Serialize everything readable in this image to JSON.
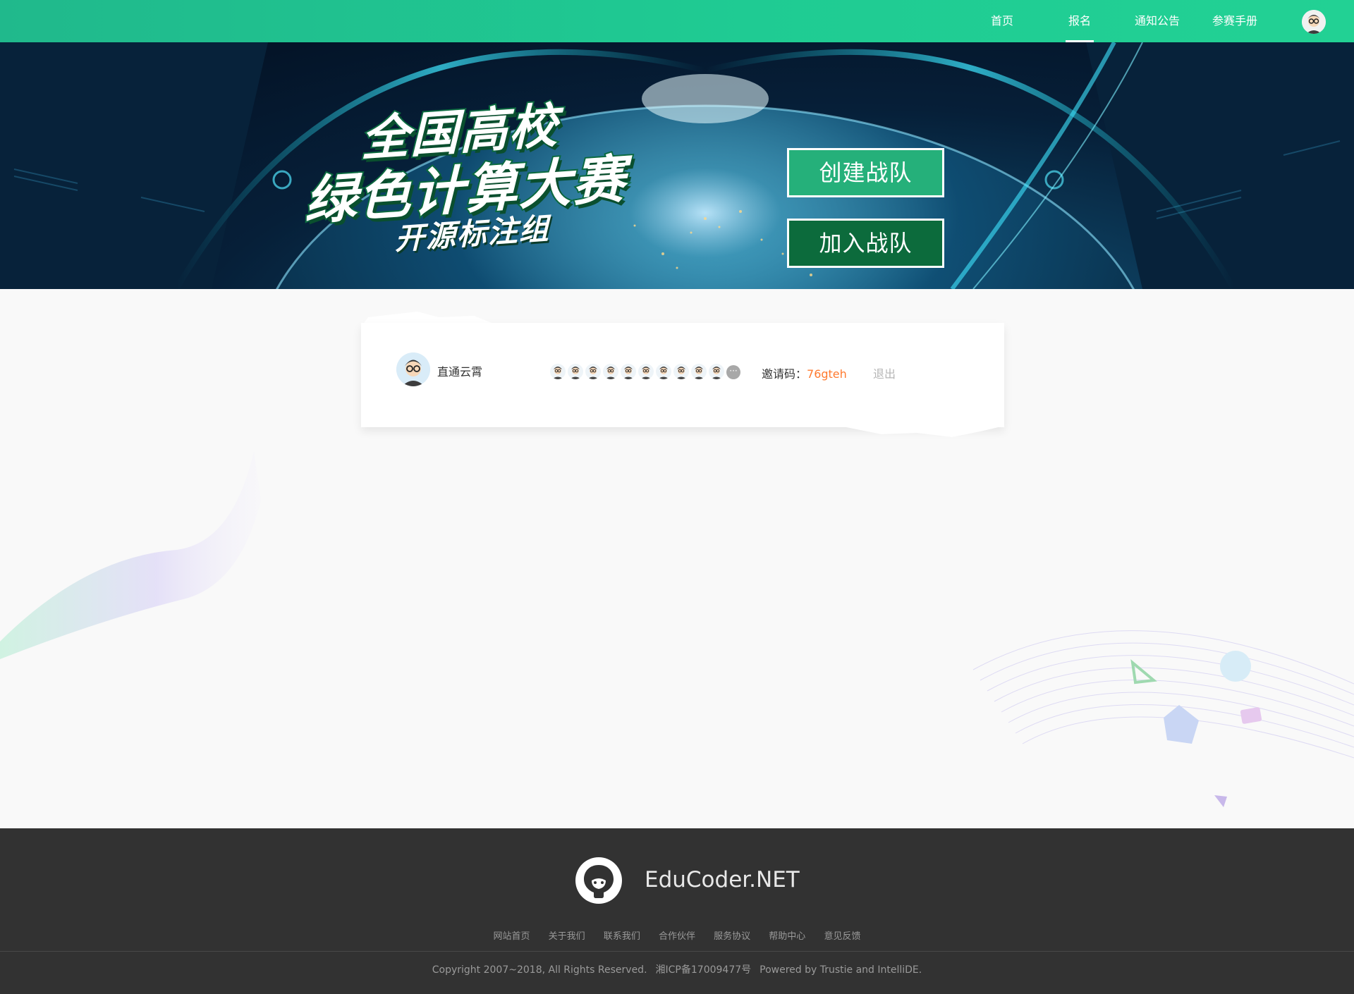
{
  "nav": {
    "items": [
      {
        "label": "首页",
        "active": false
      },
      {
        "label": "报名",
        "active": true
      },
      {
        "label": "通知公告",
        "active": false
      },
      {
        "label": "参赛手册",
        "active": false
      }
    ],
    "avatar_icon": "user-avatar-icon"
  },
  "banner": {
    "title_line1": "全国高校",
    "title_line2": "绿色计算大赛",
    "subtitle": "开源标注组",
    "create_team": "创建战队",
    "join_team": "加入战队"
  },
  "team": {
    "leader_name": "直通云霄",
    "member_count_shown": 10,
    "more_label": "···",
    "invite_label": "邀请码：",
    "invite_code": "76gteh",
    "logout_label": "退出"
  },
  "footer": {
    "brand": "EduCoder.NET",
    "links": [
      "网站首页",
      "关于我们",
      "联系我们",
      "合作伙伴",
      "服务协议",
      "帮助中心",
      "意见反馈"
    ],
    "copyright": "Copyright 2007~2018, All Rights Reserved.",
    "icp": "湘ICP备17009477号",
    "powered": "Powered by Trustie and IntelliDE."
  },
  "colors": {
    "nav_green": "#1fcb93",
    "create_btn": "#25b07a",
    "join_btn": "#0c6b3c",
    "invite_code": "#ff7a2f",
    "footer_bg": "#323232"
  }
}
